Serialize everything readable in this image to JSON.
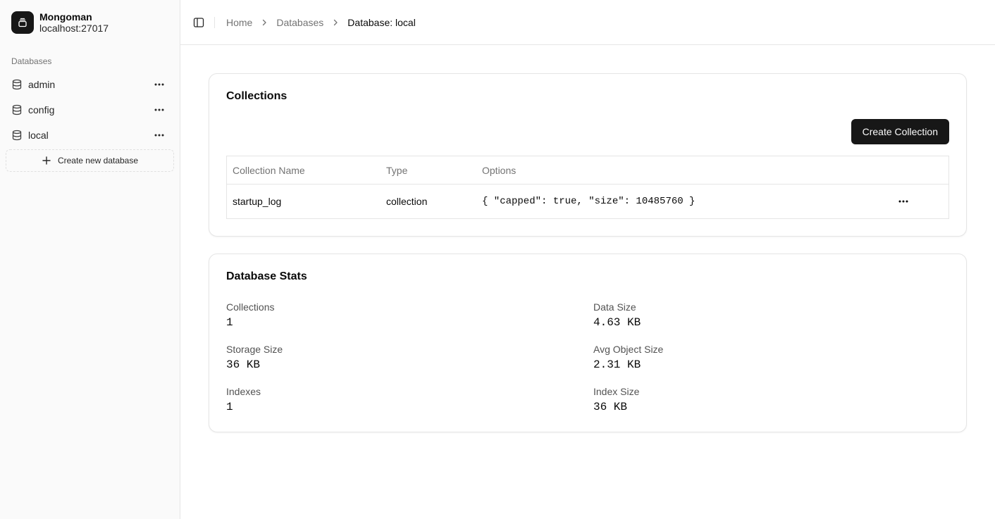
{
  "sidebar": {
    "app_name": "Mongoman",
    "host": "localhost:27017",
    "group_label": "Databases",
    "databases": [
      {
        "label": "admin"
      },
      {
        "label": "config"
      },
      {
        "label": "local"
      }
    ],
    "create_label": "Create new database"
  },
  "breadcrumb": {
    "items": [
      "Home",
      "Databases",
      "Database: local"
    ]
  },
  "collections": {
    "title": "Collections",
    "create_button": "Create Collection",
    "columns": [
      "Collection Name",
      "Type",
      "Options"
    ],
    "rows": [
      {
        "name": "startup_log",
        "type": "collection",
        "options": "{ \"capped\": true, \"size\": 10485760 }"
      }
    ]
  },
  "stats": {
    "title": "Database Stats",
    "items": [
      {
        "label": "Collections",
        "value": "1"
      },
      {
        "label": "Data Size",
        "value": "4.63 KB"
      },
      {
        "label": "Storage Size",
        "value": "36 KB"
      },
      {
        "label": "Avg Object Size",
        "value": "2.31 KB"
      },
      {
        "label": "Indexes",
        "value": "1"
      },
      {
        "label": "Index Size",
        "value": "36 KB"
      }
    ]
  },
  "icons": {
    "logo": "database-stack-icon",
    "db": "database-icon",
    "more": "more-horizontal-icon",
    "plus": "plus-icon",
    "sidebar_toggle": "panel-left-icon",
    "chevron": "chevron-right-icon"
  },
  "colors": {
    "primary": "#171717",
    "sidebar_bg": "#fafafa",
    "border": "#e5e5e5",
    "muted_text": "#737373"
  }
}
